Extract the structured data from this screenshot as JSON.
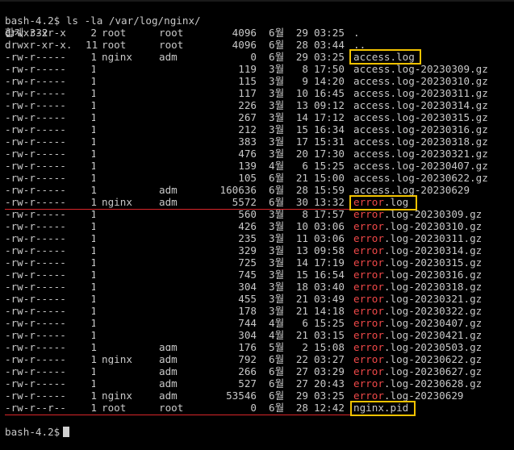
{
  "prompt_command": "bash-4.2$ ls -la /var/log/nginx/",
  "total_line": "합계 332",
  "final_prompt": "bash-4.2$",
  "rows": [
    {
      "perm": "drwxr-xr-x",
      "links": "2",
      "owner": "root",
      "group": "root",
      "size": "4096",
      "month": "6월",
      "day": "29",
      "time": "03:25",
      "name": "."
    },
    {
      "perm": "drwxr-xr-x.",
      "links": "11",
      "owner": "root",
      "group": "root",
      "size": "4096",
      "month": "6월",
      "day": "28",
      "time": "03:44",
      "name": ".."
    },
    {
      "perm": "-rw-r-----",
      "links": "1",
      "owner": "nginx",
      "group": "adm",
      "size": "0",
      "month": "6월",
      "day": "29",
      "time": "03:25",
      "name": "access.log"
    },
    {
      "perm": "-rw-r-----",
      "links": "1",
      "owner": "",
      "group": "",
      "size": "119",
      "month": "3월",
      "day": "8",
      "time": "17:50",
      "name": "access.log-20230309.gz"
    },
    {
      "perm": "-rw-r-----",
      "links": "1",
      "owner": "",
      "group": "",
      "size": "115",
      "month": "3월",
      "day": "9",
      "time": "14:20",
      "name": "access.log-20230310.gz"
    },
    {
      "perm": "-rw-r-----",
      "links": "1",
      "owner": "",
      "group": "",
      "size": "117",
      "month": "3월",
      "day": "10",
      "time": "16:45",
      "name": "access.log-20230311.gz"
    },
    {
      "perm": "-rw-r-----",
      "links": "1",
      "owner": "",
      "group": "",
      "size": "226",
      "month": "3월",
      "day": "13",
      "time": "09:12",
      "name": "access.log-20230314.gz"
    },
    {
      "perm": "-rw-r-----",
      "links": "1",
      "owner": "",
      "group": "",
      "size": "267",
      "month": "3월",
      "day": "14",
      "time": "17:12",
      "name": "access.log-20230315.gz"
    },
    {
      "perm": "-rw-r-----",
      "links": "1",
      "owner": "",
      "group": "",
      "size": "212",
      "month": "3월",
      "day": "15",
      "time": "16:34",
      "name": "access.log-20230316.gz"
    },
    {
      "perm": "-rw-r-----",
      "links": "1",
      "owner": "",
      "group": "",
      "size": "383",
      "month": "3월",
      "day": "17",
      "time": "15:31",
      "name": "access.log-20230318.gz"
    },
    {
      "perm": "-rw-r-----",
      "links": "1",
      "owner": "",
      "group": "",
      "size": "476",
      "month": "3월",
      "day": "20",
      "time": "17:30",
      "name": "access.log-20230321.gz"
    },
    {
      "perm": "-rw-r-----",
      "links": "1",
      "owner": "",
      "group": "",
      "size": "139",
      "month": "4월",
      "day": "6",
      "time": "15:25",
      "name": "access.log-20230407.gz"
    },
    {
      "perm": "-rw-r-----",
      "links": "1",
      "owner": "",
      "group": "",
      "size": "105",
      "month": "6월",
      "day": "21",
      "time": "15:00",
      "name": "access.log-20230622.gz"
    },
    {
      "perm": "-rw-r-----",
      "links": "1",
      "owner": "",
      "group": "adm",
      "size": "160636",
      "month": "6월",
      "day": "28",
      "time": "15:59",
      "name": "access.log-20230629"
    },
    {
      "perm": "-rw-r-----",
      "links": "1",
      "owner": "nginx",
      "group": "adm",
      "size": "5572",
      "month": "6월",
      "day": "30",
      "time": "13:32",
      "name": "error.log",
      "err": true
    },
    {
      "perm": "-rw-r-----",
      "links": "1",
      "owner": "",
      "group": "",
      "size": "560",
      "month": "3월",
      "day": "8",
      "time": "17:57",
      "name": "error.log-20230309.gz",
      "err": true
    },
    {
      "perm": "-rw-r-----",
      "links": "1",
      "owner": "",
      "group": "",
      "size": "426",
      "month": "3월",
      "day": "10",
      "time": "03:06",
      "name": "error.log-20230310.gz",
      "err": true
    },
    {
      "perm": "-rw-r-----",
      "links": "1",
      "owner": "",
      "group": "",
      "size": "235",
      "month": "3월",
      "day": "11",
      "time": "03:06",
      "name": "error.log-20230311.gz",
      "err": true
    },
    {
      "perm": "-rw-r-----",
      "links": "1",
      "owner": "",
      "group": "",
      "size": "329",
      "month": "3월",
      "day": "13",
      "time": "09:58",
      "name": "error.log-20230314.gz",
      "err": true
    },
    {
      "perm": "-rw-r-----",
      "links": "1",
      "owner": "",
      "group": "",
      "size": "725",
      "month": "3월",
      "day": "14",
      "time": "17:19",
      "name": "error.log-20230315.gz",
      "err": true
    },
    {
      "perm": "-rw-r-----",
      "links": "1",
      "owner": "",
      "group": "",
      "size": "745",
      "month": "3월",
      "day": "15",
      "time": "16:54",
      "name": "error.log-20230316.gz",
      "err": true
    },
    {
      "perm": "-rw-r-----",
      "links": "1",
      "owner": "",
      "group": "",
      "size": "304",
      "month": "3월",
      "day": "18",
      "time": "03:40",
      "name": "error.log-20230318.gz",
      "err": true
    },
    {
      "perm": "-rw-r-----",
      "links": "1",
      "owner": "",
      "group": "",
      "size": "455",
      "month": "3월",
      "day": "21",
      "time": "03:49",
      "name": "error.log-20230321.gz",
      "err": true
    },
    {
      "perm": "-rw-r-----",
      "links": "1",
      "owner": "",
      "group": "",
      "size": "178",
      "month": "3월",
      "day": "21",
      "time": "14:18",
      "name": "error.log-20230322.gz",
      "err": true
    },
    {
      "perm": "-rw-r-----",
      "links": "1",
      "owner": "",
      "group": "",
      "size": "744",
      "month": "4월",
      "day": "6",
      "time": "15:25",
      "name": "error.log-20230407.gz",
      "err": true
    },
    {
      "perm": "-rw-r-----",
      "links": "1",
      "owner": "",
      "group": "",
      "size": "304",
      "month": "4월",
      "day": "21",
      "time": "03:15",
      "name": "error.log-20230421.gz",
      "err": true
    },
    {
      "perm": "-rw-r-----",
      "links": "1",
      "owner": "",
      "group": "adm",
      "size": "176",
      "month": "5월",
      "day": "2",
      "time": "15:08",
      "name": "error.log-20230503.gz",
      "err": true
    },
    {
      "perm": "-rw-r-----",
      "links": "1",
      "owner": "nginx",
      "group": "adm",
      "size": "792",
      "month": "6월",
      "day": "22",
      "time": "03:27",
      "name": "error.log-20230622.gz",
      "err": true
    },
    {
      "perm": "-rw-r-----",
      "links": "1",
      "owner": "",
      "group": "adm",
      "size": "266",
      "month": "6월",
      "day": "27",
      "time": "03:29",
      "name": "error.log-20230627.gz",
      "err": true
    },
    {
      "perm": "-rw-r-----",
      "links": "1",
      "owner": "",
      "group": "adm",
      "size": "527",
      "month": "6월",
      "day": "27",
      "time": "20:43",
      "name": "error.log-20230628.gz",
      "err": true
    },
    {
      "perm": "-rw-r-----",
      "links": "1",
      "owner": "nginx",
      "group": "adm",
      "size": "53546",
      "month": "6월",
      "day": "29",
      "time": "03:25",
      "name": "error.log-20230629",
      "err": true
    },
    {
      "perm": "-rw-r--r--",
      "links": "1",
      "owner": "root",
      "group": "root",
      "size": "0",
      "month": "6월",
      "day": "28",
      "time": "12:42",
      "name": "nginx.pid"
    }
  ],
  "colors": {
    "background": "#000000",
    "text": "#c8c8c8",
    "error_prefix": "#ef4848",
    "highlight_box": "#f2c200",
    "separator": "#d9262a"
  }
}
